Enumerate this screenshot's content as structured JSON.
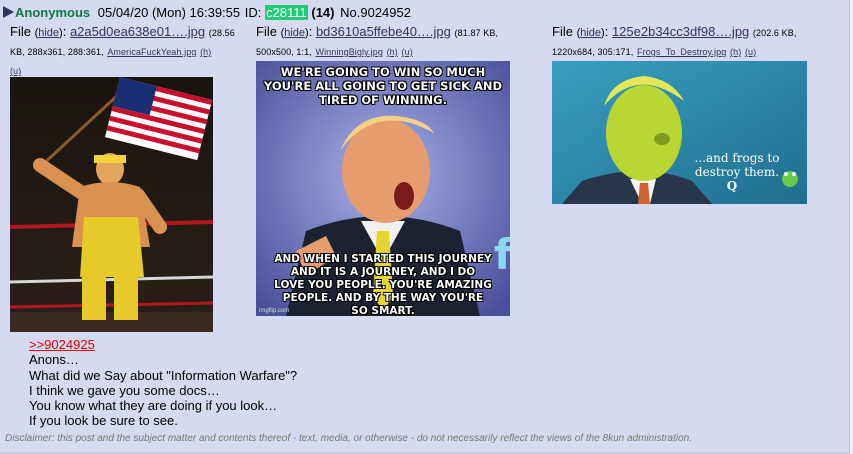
{
  "post": {
    "name": "Anonymous",
    "datetime": "05/04/20 (Mon) 16:39:55",
    "id_label": "ID:",
    "poster_id": "c28111",
    "id_count": "(14)",
    "post_no": "No.9024952"
  },
  "files": [
    {
      "label": "File",
      "hide": "hide",
      "filename": "a2a5d0ea638e01….jpg",
      "meta_a": "(28.56",
      "meta_b": "KB, 288x361, 288:361,",
      "orig_name": "AmericaFuckYeah.jpg",
      "h": "(h)",
      "u": "(u)"
    },
    {
      "label": "File",
      "hide": "hide",
      "filename": "bd3610a5ffebe40….jpg",
      "meta_a": "(81.87 KB,",
      "meta_b": "500x500, 1:1,",
      "orig_name": "WinningBigly.jpg",
      "h": "(h)",
      "u": "(u)",
      "caption_top": "WE'RE GOING TO WIN SO MUCH YOU'RE ALL GOING TO GET SICK AND TIRED OF WINNING.",
      "caption_bottom": "AND WHEN I STARTED THIS JOURNEY AND IT IS A JOURNEY, AND I DO LOVE YOU PEOPLE. YOU'RE AMAZING PEOPLE. AND BY THE WAY YOU'RE SO SMART.",
      "watermark": "imgflip.com"
    },
    {
      "label": "File",
      "hide": "hide",
      "filename": "125e2b34cc3df98….jpg",
      "meta_a": "(202.6 KB,",
      "meta_b": "1220x684, 305:171,",
      "orig_name": "Frogs_To_Destroy.jpg",
      "h": "(h)",
      "u": "(u)",
      "caption": "...and frogs to destroy them.",
      "signature": "Q"
    }
  ],
  "body": {
    "quote": ">>9024925",
    "lines": [
      "Anons…",
      "What did we Say about \"Information Warfare\"?",
      "I think we gave you some docs…",
      "You know what they are doing if you look…",
      "If you look be sure to see."
    ]
  },
  "disclaimer": "Disclaimer: this post and the subject matter and contents thereof - text, media, or otherwise - do not necessarily reflect the views of the 8kun administration.",
  "colors": {
    "post_bg": "#d6daf0",
    "name": "#117743",
    "id_bg": "#22cc77",
    "quotelink": "#dd0000",
    "link": "#34345c"
  }
}
